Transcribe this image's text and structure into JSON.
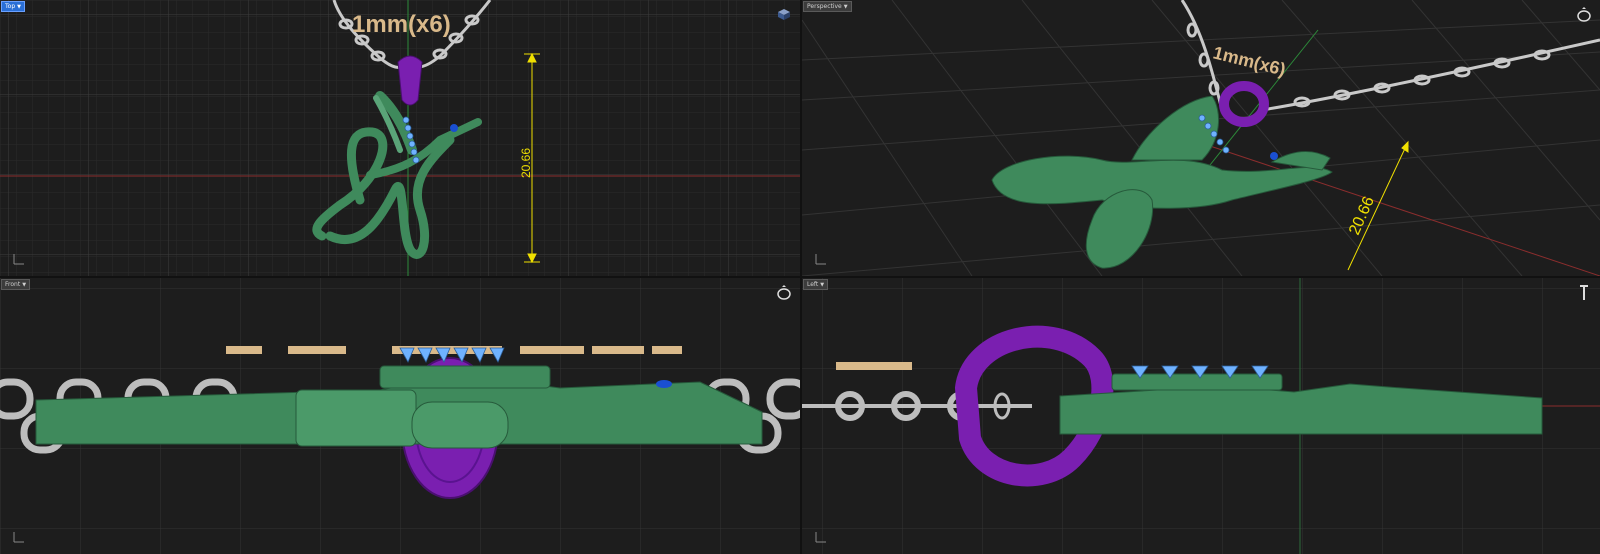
{
  "viewports": {
    "top": {
      "label": "Top",
      "active": true,
      "annotation": "1mm(x6)",
      "dimension": "20.66"
    },
    "perspective": {
      "label": "Perspective",
      "active": false,
      "annotation": "1mm(x6)",
      "dimension": "20.66"
    },
    "front": {
      "label": "Front",
      "active": false
    },
    "left": {
      "label": "Left",
      "active": false
    }
  },
  "colors": {
    "background": "#1d1d1d",
    "grid_minor": "#2a2a2a",
    "grid_major": "#3a3a3a",
    "x_axis": "#8b2d2d",
    "y_axis": "#2d8b3a",
    "pendant_green": "#3f8a5c",
    "bail_purple": "#7a1fb0",
    "gem_blue": "#6fb2ff",
    "chain_silver": "#c9c9c9",
    "label_gold": "#d9b98a",
    "dimension_yellow": "#f0e000"
  },
  "icons": {
    "top": "view-cube-icon",
    "perspective": "ring-icon",
    "front": "ring-icon",
    "left": "ring-side-icon"
  }
}
